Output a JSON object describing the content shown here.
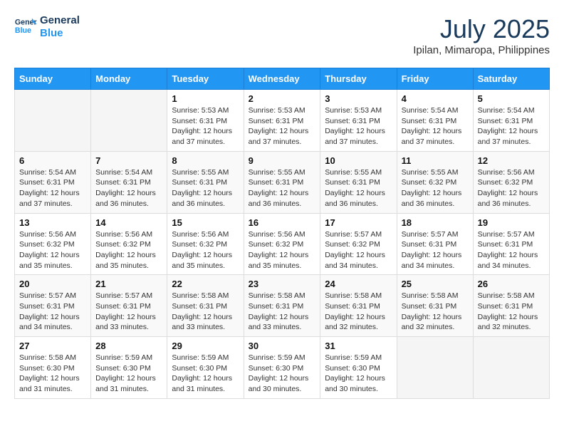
{
  "header": {
    "logo_line1": "General",
    "logo_line2": "Blue",
    "month_year": "July 2025",
    "location": "Ipilan, Mimaropa, Philippines"
  },
  "weekdays": [
    "Sunday",
    "Monday",
    "Tuesday",
    "Wednesday",
    "Thursday",
    "Friday",
    "Saturday"
  ],
  "weeks": [
    [
      {
        "day": "",
        "info": ""
      },
      {
        "day": "",
        "info": ""
      },
      {
        "day": "1",
        "info": "Sunrise: 5:53 AM\nSunset: 6:31 PM\nDaylight: 12 hours and 37 minutes."
      },
      {
        "day": "2",
        "info": "Sunrise: 5:53 AM\nSunset: 6:31 PM\nDaylight: 12 hours and 37 minutes."
      },
      {
        "day": "3",
        "info": "Sunrise: 5:53 AM\nSunset: 6:31 PM\nDaylight: 12 hours and 37 minutes."
      },
      {
        "day": "4",
        "info": "Sunrise: 5:54 AM\nSunset: 6:31 PM\nDaylight: 12 hours and 37 minutes."
      },
      {
        "day": "5",
        "info": "Sunrise: 5:54 AM\nSunset: 6:31 PM\nDaylight: 12 hours and 37 minutes."
      }
    ],
    [
      {
        "day": "6",
        "info": "Sunrise: 5:54 AM\nSunset: 6:31 PM\nDaylight: 12 hours and 37 minutes."
      },
      {
        "day": "7",
        "info": "Sunrise: 5:54 AM\nSunset: 6:31 PM\nDaylight: 12 hours and 36 minutes."
      },
      {
        "day": "8",
        "info": "Sunrise: 5:55 AM\nSunset: 6:31 PM\nDaylight: 12 hours and 36 minutes."
      },
      {
        "day": "9",
        "info": "Sunrise: 5:55 AM\nSunset: 6:31 PM\nDaylight: 12 hours and 36 minutes."
      },
      {
        "day": "10",
        "info": "Sunrise: 5:55 AM\nSunset: 6:31 PM\nDaylight: 12 hours and 36 minutes."
      },
      {
        "day": "11",
        "info": "Sunrise: 5:55 AM\nSunset: 6:32 PM\nDaylight: 12 hours and 36 minutes."
      },
      {
        "day": "12",
        "info": "Sunrise: 5:56 AM\nSunset: 6:32 PM\nDaylight: 12 hours and 36 minutes."
      }
    ],
    [
      {
        "day": "13",
        "info": "Sunrise: 5:56 AM\nSunset: 6:32 PM\nDaylight: 12 hours and 35 minutes."
      },
      {
        "day": "14",
        "info": "Sunrise: 5:56 AM\nSunset: 6:32 PM\nDaylight: 12 hours and 35 minutes."
      },
      {
        "day": "15",
        "info": "Sunrise: 5:56 AM\nSunset: 6:32 PM\nDaylight: 12 hours and 35 minutes."
      },
      {
        "day": "16",
        "info": "Sunrise: 5:56 AM\nSunset: 6:32 PM\nDaylight: 12 hours and 35 minutes."
      },
      {
        "day": "17",
        "info": "Sunrise: 5:57 AM\nSunset: 6:32 PM\nDaylight: 12 hours and 34 minutes."
      },
      {
        "day": "18",
        "info": "Sunrise: 5:57 AM\nSunset: 6:31 PM\nDaylight: 12 hours and 34 minutes."
      },
      {
        "day": "19",
        "info": "Sunrise: 5:57 AM\nSunset: 6:31 PM\nDaylight: 12 hours and 34 minutes."
      }
    ],
    [
      {
        "day": "20",
        "info": "Sunrise: 5:57 AM\nSunset: 6:31 PM\nDaylight: 12 hours and 34 minutes."
      },
      {
        "day": "21",
        "info": "Sunrise: 5:57 AM\nSunset: 6:31 PM\nDaylight: 12 hours and 33 minutes."
      },
      {
        "day": "22",
        "info": "Sunrise: 5:58 AM\nSunset: 6:31 PM\nDaylight: 12 hours and 33 minutes."
      },
      {
        "day": "23",
        "info": "Sunrise: 5:58 AM\nSunset: 6:31 PM\nDaylight: 12 hours and 33 minutes."
      },
      {
        "day": "24",
        "info": "Sunrise: 5:58 AM\nSunset: 6:31 PM\nDaylight: 12 hours and 32 minutes."
      },
      {
        "day": "25",
        "info": "Sunrise: 5:58 AM\nSunset: 6:31 PM\nDaylight: 12 hours and 32 minutes."
      },
      {
        "day": "26",
        "info": "Sunrise: 5:58 AM\nSunset: 6:31 PM\nDaylight: 12 hours and 32 minutes."
      }
    ],
    [
      {
        "day": "27",
        "info": "Sunrise: 5:58 AM\nSunset: 6:30 PM\nDaylight: 12 hours and 31 minutes."
      },
      {
        "day": "28",
        "info": "Sunrise: 5:59 AM\nSunset: 6:30 PM\nDaylight: 12 hours and 31 minutes."
      },
      {
        "day": "29",
        "info": "Sunrise: 5:59 AM\nSunset: 6:30 PM\nDaylight: 12 hours and 31 minutes."
      },
      {
        "day": "30",
        "info": "Sunrise: 5:59 AM\nSunset: 6:30 PM\nDaylight: 12 hours and 30 minutes."
      },
      {
        "day": "31",
        "info": "Sunrise: 5:59 AM\nSunset: 6:30 PM\nDaylight: 12 hours and 30 minutes."
      },
      {
        "day": "",
        "info": ""
      },
      {
        "day": "",
        "info": ""
      }
    ]
  ]
}
